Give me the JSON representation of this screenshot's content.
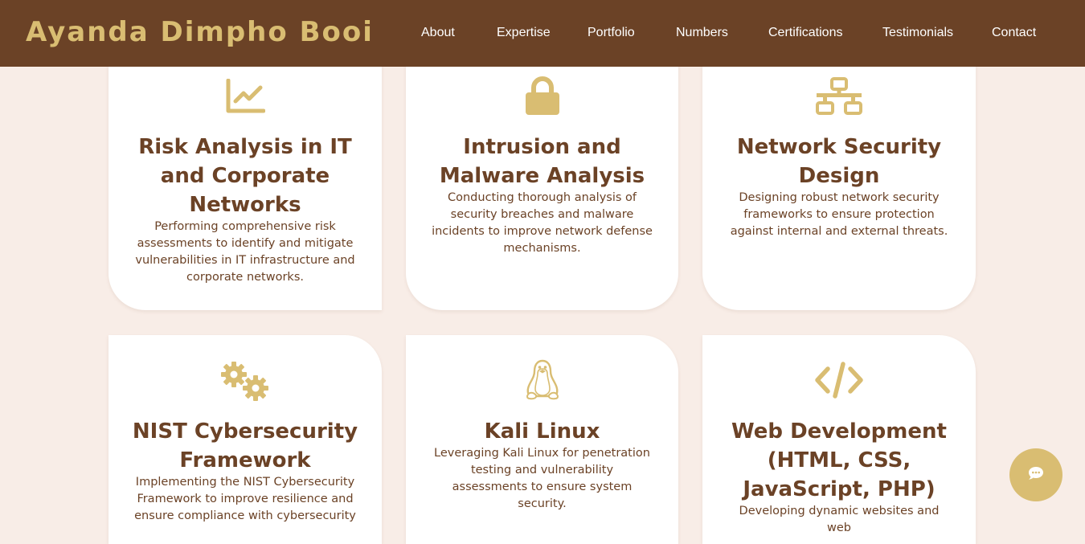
{
  "brand": {
    "name": "Ayanda Dimpho Booi"
  },
  "nav": {
    "items": [
      {
        "label": "About"
      },
      {
        "label": "Expertise"
      },
      {
        "label": "Portfolio"
      },
      {
        "label": "Numbers"
      },
      {
        "label": "Certifications"
      },
      {
        "label": "Testimonials"
      },
      {
        "label": "Contact"
      }
    ]
  },
  "cards": [
    {
      "icon": "chart-line-icon",
      "title": "Risk Analysis in IT and Corporate Networks",
      "description": "Performing comprehensive risk assessments to identify and mitigate vulnerabilities in IT infrastructure and corporate networks."
    },
    {
      "icon": "lock-icon",
      "title": "Intrusion and Malware Analysis",
      "description": "Conducting thorough analysis of security breaches and malware incidents to improve network defense mechanisms."
    },
    {
      "icon": "network-wired-icon",
      "title": "Network Security Design",
      "description": "Designing robust network security frameworks to ensure protection against internal and external threats."
    },
    {
      "icon": "cogs-icon",
      "title": "NIST Cybersecurity Framework",
      "description": "Implementing the NIST Cybersecurity Framework to improve resilience and ensure compliance with cybersecurity"
    },
    {
      "icon": "linux-tux-icon",
      "title": "Kali Linux",
      "description": "Leveraging Kali Linux for penetration testing and vulnerability assessments to ensure system security."
    },
    {
      "icon": "code-icon",
      "title": "Web Development (HTML, CSS, JavaScript, PHP)",
      "description": "Developing dynamic websites and web"
    }
  ],
  "chat": {
    "icon": "chat-bubble-icon"
  },
  "colors": {
    "accent": "#d9bd72",
    "brown": "#6b4226",
    "background": "#f8ede7",
    "card": "#ffffff"
  }
}
